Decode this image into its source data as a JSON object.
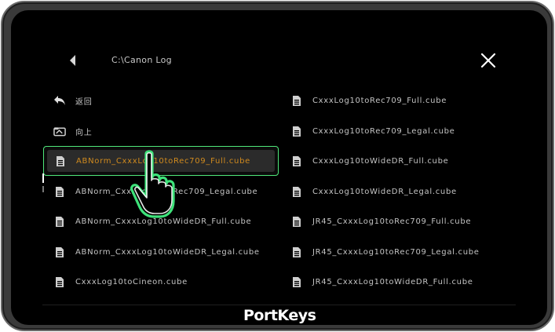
{
  "header": {
    "path": "C:\\Canon Log"
  },
  "items": [
    {
      "label": "返回",
      "icon": "return-arrow-icon",
      "col": "left",
      "row": 0
    },
    {
      "label": "向上",
      "icon": "folder-up-icon",
      "col": "left",
      "row": 1
    },
    {
      "label": "ABNorm_CxxxLog10toRec709_Full.cube",
      "icon": "file-icon",
      "col": "left",
      "row": 2,
      "selected": true
    },
    {
      "label": "ABNorm_CxxxLog10toRec709_Legal.cube",
      "icon": "file-icon",
      "col": "left",
      "row": 3
    },
    {
      "label": "ABNorm_CxxxLog10toWideDR_Full.cube",
      "icon": "file-icon",
      "col": "left",
      "row": 4
    },
    {
      "label": "ABNorm_CxxxLog10toWideDR_Legal.cube",
      "icon": "file-icon",
      "col": "left",
      "row": 5
    },
    {
      "label": "CxxxLog10toCineon.cube",
      "icon": "file-icon",
      "col": "left",
      "row": 6
    },
    {
      "label": "CxxxLog10toRec709_Full.cube",
      "icon": "file-icon",
      "col": "right",
      "row": 0
    },
    {
      "label": "CxxxLog10toRec709_Legal.cube",
      "icon": "file-icon",
      "col": "right",
      "row": 1
    },
    {
      "label": "CxxxLog10toWideDR_Full.cube",
      "icon": "file-icon",
      "col": "right",
      "row": 2
    },
    {
      "label": "CxxxLog10toWideDR_Legal.cube",
      "icon": "file-icon",
      "col": "right",
      "row": 3
    },
    {
      "label": "JR45_CxxxLog10toRec709_Full.cube",
      "icon": "file-icon",
      "col": "right",
      "row": 4
    },
    {
      "label": "JR45_CxxxLog10toRec709_Legal.cube",
      "icon": "file-icon",
      "col": "right",
      "row": 5
    },
    {
      "label": "JR45_CxxxLog10toWideDR_Full.cube",
      "icon": "file-icon",
      "col": "right",
      "row": 6
    }
  ],
  "footer": {
    "logo": "PortKeys"
  },
  "colors": {
    "selection_border": "#4fe87a",
    "selected_text": "#d08a1e",
    "text": "#c4c4c4",
    "background": "#000000",
    "hand_outline": "#3ee27a"
  }
}
